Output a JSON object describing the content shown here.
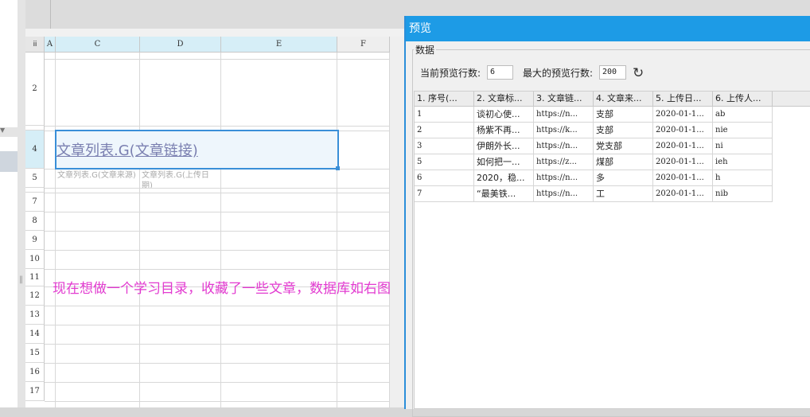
{
  "sheet": {
    "corner": "iii",
    "columns": [
      "A",
      "C",
      "D",
      "E",
      "F"
    ],
    "rows": [
      "2",
      "4",
      "5",
      "7",
      "8",
      "9",
      "10",
      "11",
      "12",
      "13",
      "14",
      "15",
      "16",
      "17"
    ],
    "cell_c4": "文章列表.G(文章链接)",
    "cell_c5": "文章列表.G(文章来源)",
    "cell_d5": "文章列表.G(上传日期)",
    "note": "现在想做一个学习目录，收藏了一些文章，数据库如右图"
  },
  "dialog": {
    "title": "预览",
    "group_label": "数据",
    "current_rows_label": "当前预览行数:",
    "current_rows_value": "6",
    "max_rows_label": "最大的预览行数:",
    "max_rows_value": "200",
    "refresh_icon": "refresh-icon",
    "headers": [
      "1. 序号(...",
      "2. 文章标...",
      "3. 文章链...",
      "4. 文章来...",
      "5. 上传日...",
      "6. 上传人..."
    ],
    "rows": [
      [
        "1",
        "谈初心使...",
        "https://n...",
        "支部",
        "2020-01-1...",
        "ab"
      ],
      [
        "2",
        "杨紫不再...",
        "https://k...",
        "支部",
        "2020-01-1...",
        "nie"
      ],
      [
        "3",
        "伊朗外长...",
        "https://n...",
        "党支部",
        "2020-01-1...",
        "ni"
      ],
      [
        "5",
        "如何把一...",
        "https://z...",
        "煤部",
        "2020-01-1...",
        "ieh"
      ],
      [
        "6",
        "2020，稳...",
        "https://n...",
        "多",
        "2020-01-1...",
        "h"
      ],
      [
        "7",
        "“最美铁...",
        "https://n...",
        "工",
        "2020-01-1...",
        "nib"
      ]
    ]
  }
}
